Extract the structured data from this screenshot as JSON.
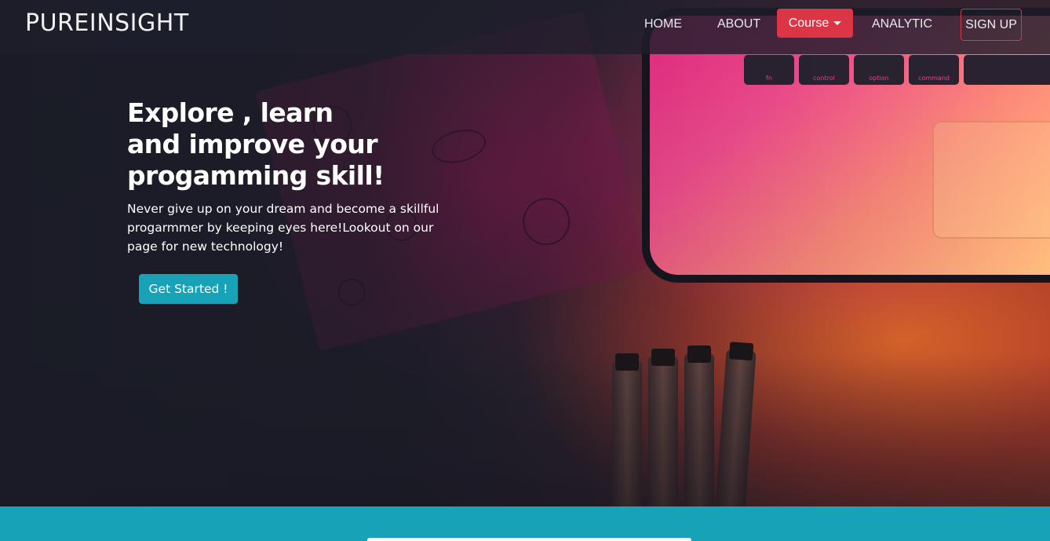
{
  "navbar": {
    "brand": "PUREINSIGHT",
    "links": {
      "home": "HOME",
      "about": "ABOUT",
      "course": "Course",
      "analytic": "ANALYTIC",
      "signup": "SIGN UP"
    }
  },
  "hero": {
    "headline": "Explore , learn and improve your progamming skill!",
    "subtext": "Never give up on your dream and become a skillful progarmmer by keeping eyes here!Lookout on our page for new technology!",
    "cta_label": "Get Started !"
  },
  "colors": {
    "navbar_bg": "#1e1e2c",
    "accent_danger": "#dc3545",
    "accent_info": "#17a2b8",
    "text": "#ffffff"
  },
  "icons": {
    "course_caret": "caret-down-icon"
  }
}
